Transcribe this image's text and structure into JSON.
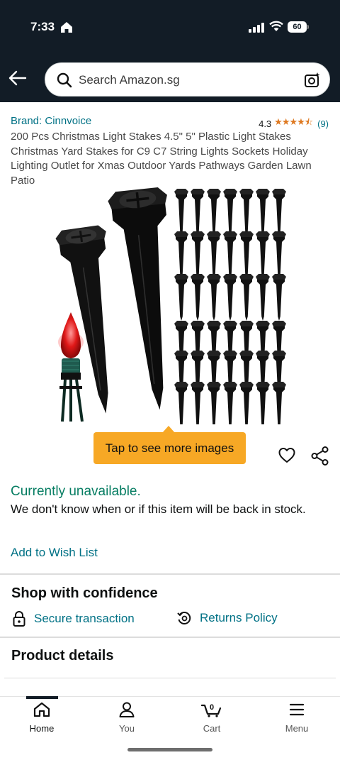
{
  "status_bar": {
    "time": "7:33",
    "battery": "60"
  },
  "search": {
    "placeholder": "Search Amazon.sg"
  },
  "product": {
    "brand": "Brand: Cinnvoice",
    "rating_value": "4.3",
    "rating_stars": "★★★★⯪",
    "rating_count": "(9)",
    "title": "200 Pcs Christmas Light Stakes 4.5\" 5\" Plastic Light Stakes Christmas Yard Stakes for C9 C7 String Lights Sockets Holiday Lighting Outlet for Xmas Outdoor Yards Pathways Garden Lawn Patio"
  },
  "image_banner": {
    "label": "Tap to see more images"
  },
  "availability": {
    "status": "Currently unavailable.",
    "note": "We don't know when or if this item will be back in stock."
  },
  "actions": {
    "wishlist": "Add to Wish List"
  },
  "confidence": {
    "heading": "Shop with confidence",
    "secure": "Secure transaction",
    "returns": "Returns Policy"
  },
  "details": {
    "heading": "Product details"
  },
  "bottom_nav": {
    "items": [
      {
        "label": "Home",
        "icon": "home-icon"
      },
      {
        "label": "You",
        "icon": "person-icon"
      },
      {
        "label": "Cart",
        "icon": "cart-icon",
        "badge": "0"
      },
      {
        "label": "Menu",
        "icon": "menu-icon"
      }
    ]
  },
  "colors": {
    "header_bg": "#121c26",
    "link": "#007185",
    "available_green": "#067d62",
    "banner_orange": "#f7a825",
    "star": "#de7921"
  }
}
